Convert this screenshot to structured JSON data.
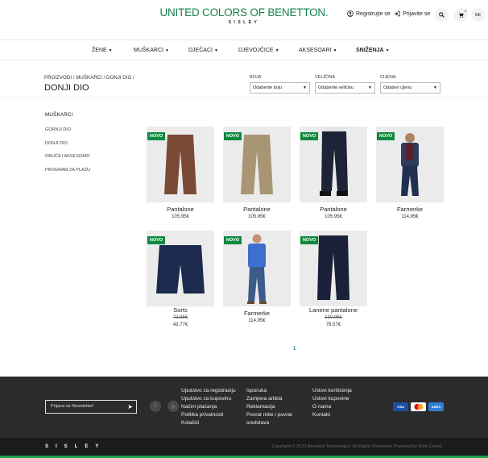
{
  "header": {
    "logo": "UNITED COLORS OF BENETTON.",
    "logo_sub": "SISLEY",
    "register": "Registrujte se",
    "login": "Prijavite se",
    "cart_count": "0",
    "lang": "ME"
  },
  "nav": {
    "items": [
      "ŽENE",
      "MUŠKARCI",
      "DJEČACI",
      "DJEVOJČICE",
      "AKSESOARI",
      "SNIŽENJA"
    ]
  },
  "breadcrumb": "PROIZVODI / MUŠKARCI / DONJI DIO /",
  "page_title": "DONJI DIO",
  "filters": [
    {
      "label": "BOJA",
      "value": "Odaberite boju"
    },
    {
      "label": "VELIČINA",
      "value": "Odaberite veličinu"
    },
    {
      "label": "CIJENA",
      "value": "Odaberi cijenu"
    }
  ],
  "sidebar": {
    "heading": "MUŠKARCI",
    "items": [
      "GORNJI DIO",
      "DONJI DIO",
      "OBUĆA I AKSESOARI",
      "PROGRAM ZA PLAŽU"
    ]
  },
  "badge_label": "NOVO",
  "products": [
    {
      "name": "Pantalone",
      "price": "105.95€",
      "old_price": "",
      "color": "#7b4a36"
    },
    {
      "name": "Pantalone",
      "price": "105.95€",
      "old_price": "",
      "color": "#a89574"
    },
    {
      "name": "Pantalone",
      "price": "105.95€",
      "old_price": "",
      "color": "#1d2438"
    },
    {
      "name": "Farmerke",
      "price": "114.95€",
      "old_price": "",
      "color": "#22304f"
    },
    {
      "name": "Sorts",
      "price": "43.77€",
      "old_price": "72.95€",
      "color": "#1c2a4e"
    },
    {
      "name": "Farmerke",
      "price": "114.95€",
      "old_price": "",
      "color": "#3c5a8a"
    },
    {
      "name": "Lanene pantalone",
      "price": "78.57€",
      "old_price": "130.95€",
      "color": "#1a2138"
    }
  ],
  "pagination": "1",
  "footer": {
    "newsletter_placeholder": "Prijava na Newsletter!",
    "col1": [
      "Uputstvo za registraciju",
      "Uputstvo za kupovinu",
      "Načini plaćanja",
      "Politika privatnosti",
      "Kolačići"
    ],
    "col2": [
      "Isporuka",
      "Zamjena artikla",
      "Reklamacija",
      "Povrat robe i povrat",
      "sredstava"
    ],
    "col3": [
      "Uslovi korišćenja",
      "Uslovi kupovine",
      "O nama",
      "Kontakt"
    ],
    "payments": [
      "VISA",
      "mc",
      "AMEX"
    ],
    "bottom_logo": "SISLEY",
    "copyright": "Copyright © 2020 Benetton Montenegro. All Rights Reserved. Powered by Web Centar."
  }
}
